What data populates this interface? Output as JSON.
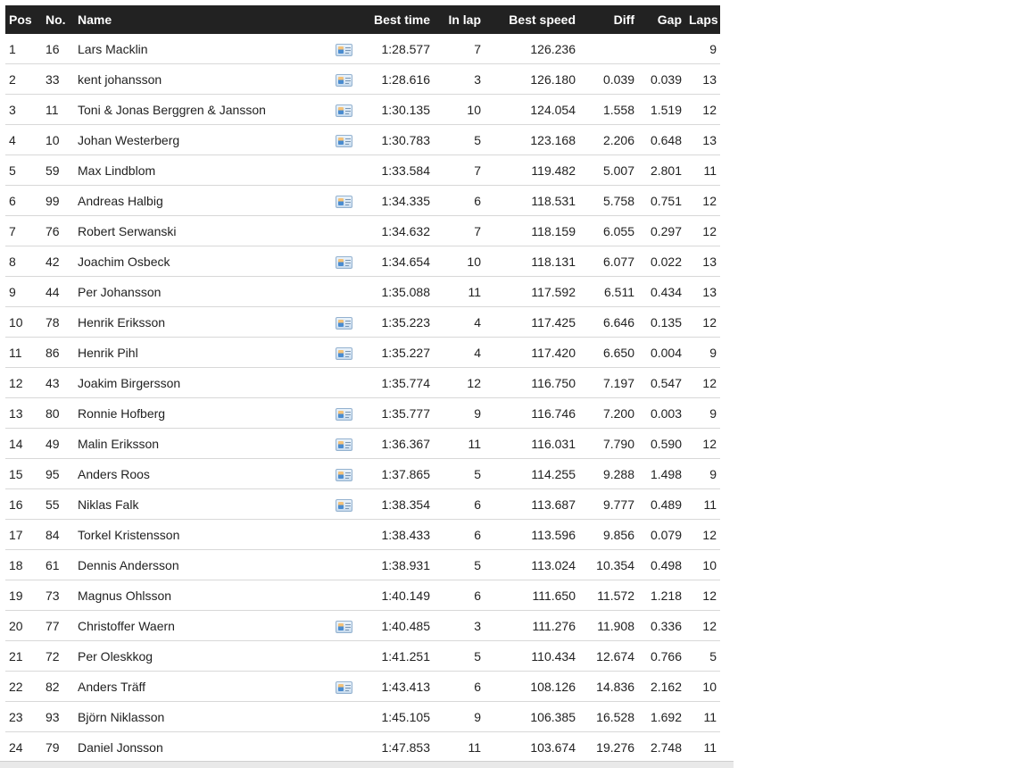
{
  "columns": [
    "Pos",
    "No.",
    "Name",
    "",
    "Best time",
    "In lap",
    "Best speed",
    "Diff",
    "Gap",
    "Laps"
  ],
  "rows": [
    {
      "pos": "1",
      "no": "16",
      "name": "Lars Macklin",
      "icon": true,
      "best_time": "1:28.577",
      "in_lap": "7",
      "best_speed": "126.236",
      "diff": "",
      "gap": "",
      "laps": "9"
    },
    {
      "pos": "2",
      "no": "33",
      "name": "kent johansson",
      "icon": true,
      "best_time": "1:28.616",
      "in_lap": "3",
      "best_speed": "126.180",
      "diff": "0.039",
      "gap": "0.039",
      "laps": "13"
    },
    {
      "pos": "3",
      "no": "11",
      "name": "Toni & Jonas Berggren & Jansson",
      "icon": true,
      "best_time": "1:30.135",
      "in_lap": "10",
      "best_speed": "124.054",
      "diff": "1.558",
      "gap": "1.519",
      "laps": "12"
    },
    {
      "pos": "4",
      "no": "10",
      "name": "Johan Westerberg",
      "icon": true,
      "best_time": "1:30.783",
      "in_lap": "5",
      "best_speed": "123.168",
      "diff": "2.206",
      "gap": "0.648",
      "laps": "13"
    },
    {
      "pos": "5",
      "no": "59",
      "name": "Max Lindblom",
      "icon": false,
      "best_time": "1:33.584",
      "in_lap": "7",
      "best_speed": "119.482",
      "diff": "5.007",
      "gap": "2.801",
      "laps": "11"
    },
    {
      "pos": "6",
      "no": "99",
      "name": "Andreas Halbig",
      "icon": true,
      "best_time": "1:34.335",
      "in_lap": "6",
      "best_speed": "118.531",
      "diff": "5.758",
      "gap": "0.751",
      "laps": "12"
    },
    {
      "pos": "7",
      "no": "76",
      "name": "Robert Serwanski",
      "icon": false,
      "best_time": "1:34.632",
      "in_lap": "7",
      "best_speed": "118.159",
      "diff": "6.055",
      "gap": "0.297",
      "laps": "12"
    },
    {
      "pos": "8",
      "no": "42",
      "name": "Joachim Osbeck",
      "icon": true,
      "best_time": "1:34.654",
      "in_lap": "10",
      "best_speed": "118.131",
      "diff": "6.077",
      "gap": "0.022",
      "laps": "13"
    },
    {
      "pos": "9",
      "no": "44",
      "name": "Per Johansson",
      "icon": false,
      "best_time": "1:35.088",
      "in_lap": "11",
      "best_speed": "117.592",
      "diff": "6.511",
      "gap": "0.434",
      "laps": "13"
    },
    {
      "pos": "10",
      "no": "78",
      "name": "Henrik Eriksson",
      "icon": true,
      "best_time": "1:35.223",
      "in_lap": "4",
      "best_speed": "117.425",
      "diff": "6.646",
      "gap": "0.135",
      "laps": "12"
    },
    {
      "pos": "11",
      "no": "86",
      "name": "Henrik Pihl",
      "icon": true,
      "best_time": "1:35.227",
      "in_lap": "4",
      "best_speed": "117.420",
      "diff": "6.650",
      "gap": "0.004",
      "laps": "9"
    },
    {
      "pos": "12",
      "no": "43",
      "name": "Joakim Birgersson",
      "icon": false,
      "best_time": "1:35.774",
      "in_lap": "12",
      "best_speed": "116.750",
      "diff": "7.197",
      "gap": "0.547",
      "laps": "12"
    },
    {
      "pos": "13",
      "no": "80",
      "name": "Ronnie Hofberg",
      "icon": true,
      "best_time": "1:35.777",
      "in_lap": "9",
      "best_speed": "116.746",
      "diff": "7.200",
      "gap": "0.003",
      "laps": "9"
    },
    {
      "pos": "14",
      "no": "49",
      "name": "Malin Eriksson",
      "icon": true,
      "best_time": "1:36.367",
      "in_lap": "11",
      "best_speed": "116.031",
      "diff": "7.790",
      "gap": "0.590",
      "laps": "12"
    },
    {
      "pos": "15",
      "no": "95",
      "name": "Anders Roos",
      "icon": true,
      "best_time": "1:37.865",
      "in_lap": "5",
      "best_speed": "114.255",
      "diff": "9.288",
      "gap": "1.498",
      "laps": "9"
    },
    {
      "pos": "16",
      "no": "55",
      "name": "Niklas Falk",
      "icon": true,
      "best_time": "1:38.354",
      "in_lap": "6",
      "best_speed": "113.687",
      "diff": "9.777",
      "gap": "0.489",
      "laps": "11"
    },
    {
      "pos": "17",
      "no": "84",
      "name": "Torkel Kristensson",
      "icon": false,
      "best_time": "1:38.433",
      "in_lap": "6",
      "best_speed": "113.596",
      "diff": "9.856",
      "gap": "0.079",
      "laps": "12"
    },
    {
      "pos": "18",
      "no": "61",
      "name": "Dennis Andersson",
      "icon": false,
      "best_time": "1:38.931",
      "in_lap": "5",
      "best_speed": "113.024",
      "diff": "10.354",
      "gap": "0.498",
      "laps": "10"
    },
    {
      "pos": "19",
      "no": "73",
      "name": "Magnus Ohlsson",
      "icon": false,
      "best_time": "1:40.149",
      "in_lap": "6",
      "best_speed": "111.650",
      "diff": "11.572",
      "gap": "1.218",
      "laps": "12"
    },
    {
      "pos": "20",
      "no": "77",
      "name": "Christoffer Waern",
      "icon": true,
      "best_time": "1:40.485",
      "in_lap": "3",
      "best_speed": "111.276",
      "diff": "11.908",
      "gap": "0.336",
      "laps": "12"
    },
    {
      "pos": "21",
      "no": "72",
      "name": "Per Oleskkog",
      "icon": false,
      "best_time": "1:41.251",
      "in_lap": "5",
      "best_speed": "110.434",
      "diff": "12.674",
      "gap": "0.766",
      "laps": "5"
    },
    {
      "pos": "22",
      "no": "82",
      "name": "Anders Träff",
      "icon": true,
      "best_time": "1:43.413",
      "in_lap": "6",
      "best_speed": "108.126",
      "diff": "14.836",
      "gap": "2.162",
      "laps": "10"
    },
    {
      "pos": "23",
      "no": "93",
      "name": "Björn Niklasson",
      "icon": false,
      "best_time": "1:45.105",
      "in_lap": "9",
      "best_speed": "106.385",
      "diff": "16.528",
      "gap": "1.692",
      "laps": "11"
    },
    {
      "pos": "24",
      "no": "79",
      "name": "Daniel Jonsson",
      "icon": false,
      "best_time": "1:47.853",
      "in_lap": "11",
      "best_speed": "103.674",
      "diff": "19.276",
      "gap": "2.748",
      "laps": "11"
    }
  ],
  "icons": {
    "driver_card": "driver-card-icon"
  },
  "colors": {
    "header_bg": "#222222",
    "header_text": "#ffffff",
    "row_border": "#d8d8d8"
  }
}
